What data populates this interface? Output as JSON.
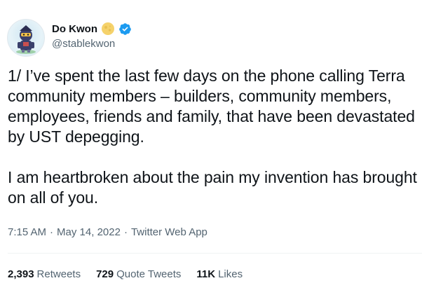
{
  "author": {
    "name": "Do Kwon",
    "handle": "@stablekwon",
    "verified_color": "#1d9bf0",
    "moon_badge_color": "#f5d26b"
  },
  "tweet": {
    "paragraphs": [
      "1/ I’ve spent the last few days on the phone calling Terra community members – builders, community members, employees, friends and family, that have been devastated by UST depegging.",
      "I am heartbroken about the pain my invention has brought on all of you."
    ],
    "time": "7:15 AM",
    "date": "May 14, 2022",
    "source": "Twitter Web App",
    "separator": "·"
  },
  "stats": {
    "retweets": {
      "count": "2,393",
      "label": "Retweets"
    },
    "quote_tweets": {
      "count": "729",
      "label": "Quote Tweets"
    },
    "likes": {
      "count": "11K",
      "label": "Likes"
    }
  }
}
